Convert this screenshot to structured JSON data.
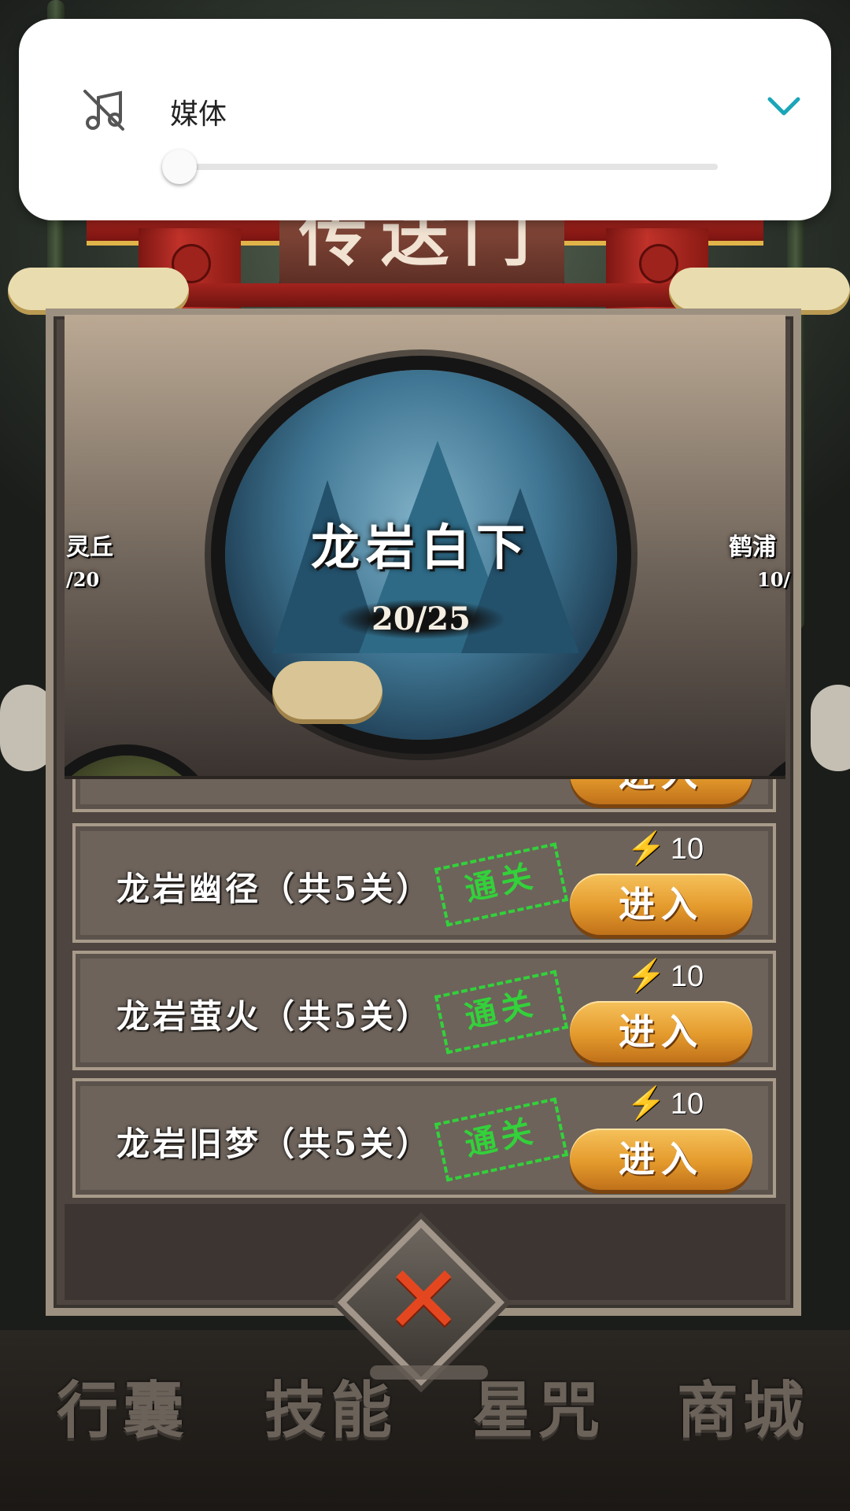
{
  "volume_panel": {
    "label": "媒体",
    "level": 0,
    "icon": "music-off-icon",
    "expand_icon": "chevron-down-icon",
    "accent_color": "#1aa6b8"
  },
  "gate": {
    "title": "传送门"
  },
  "portal": {
    "current": {
      "name": "龙岩白下",
      "progress": "20/25"
    },
    "left": {
      "name": "灵丘",
      "progress": "/20"
    },
    "right": {
      "name": "鹤浦",
      "progress": "10/"
    }
  },
  "levels": [
    {
      "name": "龙岩幽径（共5关）",
      "stamp": "通关",
      "energy": "10",
      "button": "进入"
    },
    {
      "name": "龙岩萤火（共5关）",
      "stamp": "通关",
      "energy": "10",
      "button": "进入"
    },
    {
      "name": "龙岩旧梦（共5关）",
      "stamp": "通关",
      "energy": "10",
      "button": "进入"
    }
  ],
  "partial_row": {
    "button": "进入"
  },
  "bottom_nav": [
    "行囊",
    "技能",
    "星咒",
    "商城"
  ],
  "colors": {
    "stamp": "#33d13a",
    "energy_icon": "#2fb4ff",
    "close_x": "#e4471f"
  }
}
